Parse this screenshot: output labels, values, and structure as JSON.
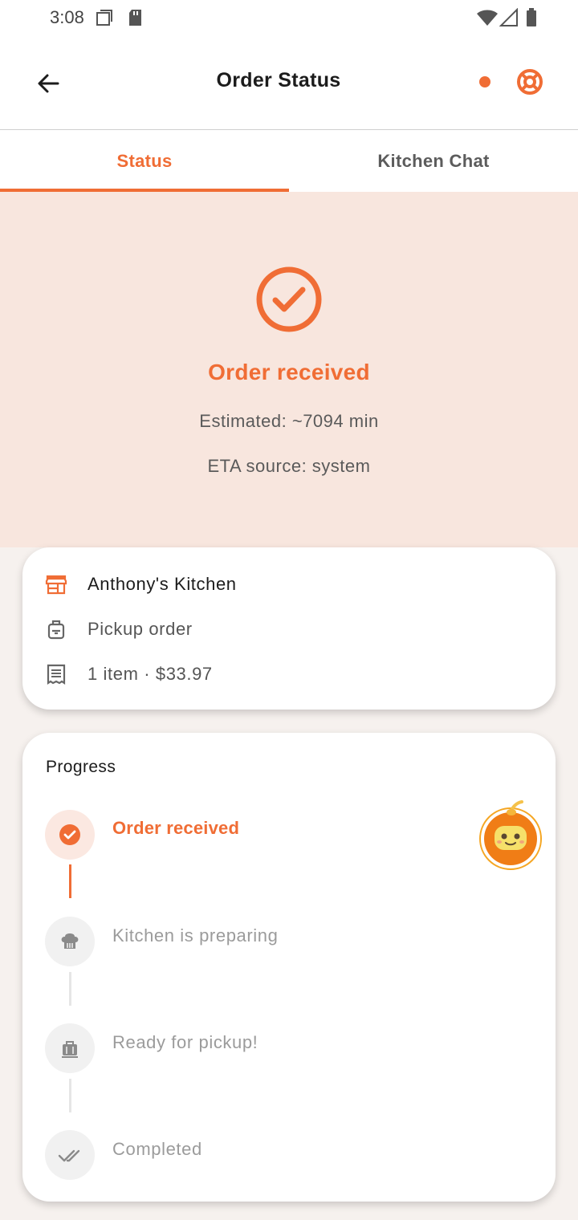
{
  "status_bar": {
    "time": "3:08",
    "icons": [
      "screenshot-icon",
      "sd-card-icon",
      "wifi-icon",
      "signal-icon",
      "battery-icon"
    ]
  },
  "app_bar": {
    "title": "Order Status",
    "back_icon": "arrow-left-icon",
    "help_icon": "lifebuoy-icon"
  },
  "tabs": [
    {
      "label": "Status",
      "selected": true
    },
    {
      "label": "Kitchen Chat",
      "selected": false
    }
  ],
  "hero": {
    "icon": "check-circle-icon",
    "title": "Order received",
    "estimated": "Estimated: ~7094 min",
    "eta_source": "ETA source: system"
  },
  "order_info": {
    "kitchen_name": "Anthony's Kitchen",
    "order_type": "Pickup order",
    "summary": "1 item · $33.97"
  },
  "progress": {
    "title": "Progress",
    "steps": [
      {
        "label": "Order received",
        "state": "active",
        "icon": "check-icon"
      },
      {
        "label": "Kitchen is preparing",
        "state": "pending",
        "icon": "chef-hat-icon"
      },
      {
        "label": "Ready for pickup!",
        "state": "pending",
        "icon": "bag-icon"
      },
      {
        "label": "Completed",
        "state": "pending",
        "icon": "double-check-icon"
      }
    ]
  },
  "colors": {
    "accent": "#f06d35",
    "hero_bg": "#f8e6de",
    "page_bg": "#f6f1ee"
  }
}
